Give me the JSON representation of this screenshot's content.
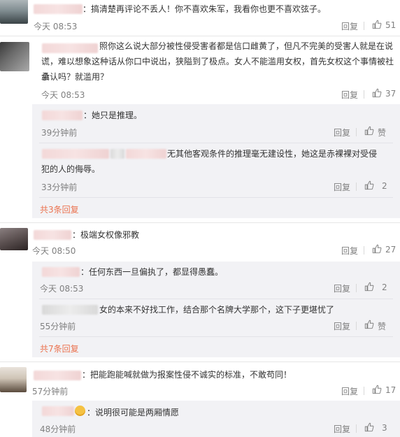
{
  "colors": {
    "link": "#eb7350",
    "meta": "#808080",
    "sub_bg": "#f2f2f5"
  },
  "comments": [
    {
      "text": "：搞清楚再评论不丢人！你不喜欢朱军，我看你也更不喜欢弦子。",
      "time": "今天 08:53",
      "reply": "回复",
      "likes": "51"
    },
    {
      "text_line1": "照你这么说大部分被性侵受害者都是信口雌黄了，但凡不完美的受害人就是在说",
      "text_line2": "谎，难以想象这种话从你口中说出，狭隘到了极点。女人不能滥用女权，首先女权这个事情被社会",
      "text_line3": "承认吗？就滥用？",
      "time": "今天 08:53",
      "reply": "回复",
      "likes": "37",
      "subs": [
        {
          "text": "：她只是推理。",
          "time": "39分钟前",
          "reply": "回复",
          "likes": "赞"
        },
        {
          "text_line1": "无其他客观条件的推理毫无建设性，她这是赤裸裸对受侵",
          "text_line2": "犯的人的侮辱。",
          "time": "33分钟前",
          "reply": "回复",
          "likes": "2"
        }
      ],
      "more": "共3条回复"
    },
    {
      "text": "：极端女权像邪教",
      "time": "今天 08:50",
      "reply": "回复",
      "likes": "27",
      "subs": [
        {
          "text": "：任何东西一旦偏执了，都显得愚蠢。",
          "time": "今天 08:53",
          "reply": "回复",
          "likes": "2"
        },
        {
          "text": "女的本来不好找工作，结合那个名牌大学那个，这下子更堪忧了",
          "time": "55分钟前",
          "reply": "回复",
          "likes": "赞"
        }
      ],
      "more": "共7条回复"
    },
    {
      "text": "：把能跑能喊就做为报案性侵不诚实的标准，不敢苟同！",
      "time": "57分钟前",
      "reply": "回复",
      "likes": "17",
      "subs": [
        {
          "text": "：说明很可能是两厢情愿",
          "time": "48分钟前",
          "reply": "回复",
          "likes": "3"
        }
      ]
    }
  ]
}
